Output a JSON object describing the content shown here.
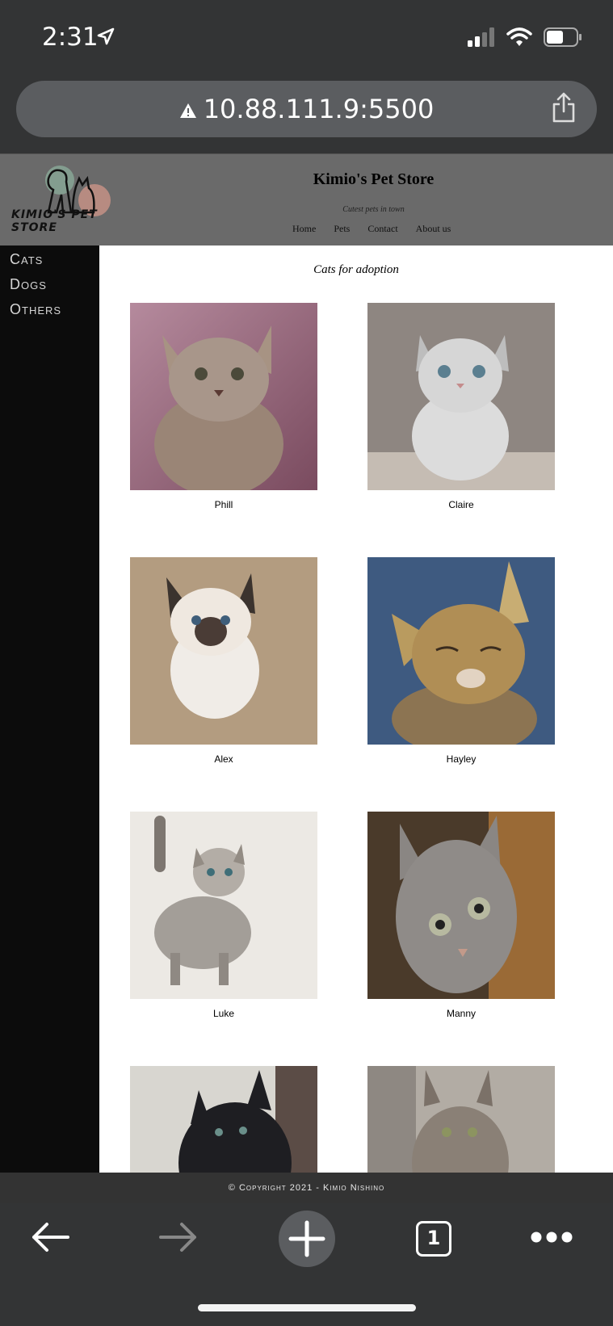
{
  "status_bar": {
    "time": "2:31"
  },
  "browser": {
    "url": "10.88.111.9:5500",
    "tab_count": "1"
  },
  "site": {
    "logo_text": "KIMIO'S PET STORE",
    "title": "Kimio's Pet Store",
    "tagline": "Cutest pets in town",
    "nav": [
      "Home",
      "Pets",
      "Contact",
      "About us"
    ]
  },
  "sidebar": {
    "items": [
      {
        "label": "Cats"
      },
      {
        "label": "Dogs"
      },
      {
        "label": "Others"
      }
    ]
  },
  "main": {
    "title": "Cats for adoption",
    "pets": [
      {
        "name": "Phill"
      },
      {
        "name": "Claire"
      },
      {
        "name": "Alex"
      },
      {
        "name": "Hayley"
      },
      {
        "name": "Luke"
      },
      {
        "name": "Manny"
      },
      {
        "name": ""
      },
      {
        "name": ""
      }
    ]
  },
  "footer": {
    "text": "© Copyright 2021 - Kimio Nishino"
  },
  "colors": {
    "chrome": "#333435",
    "header_bg": "#6a6a6a",
    "sidebar_bg": "#0c0c0c"
  }
}
